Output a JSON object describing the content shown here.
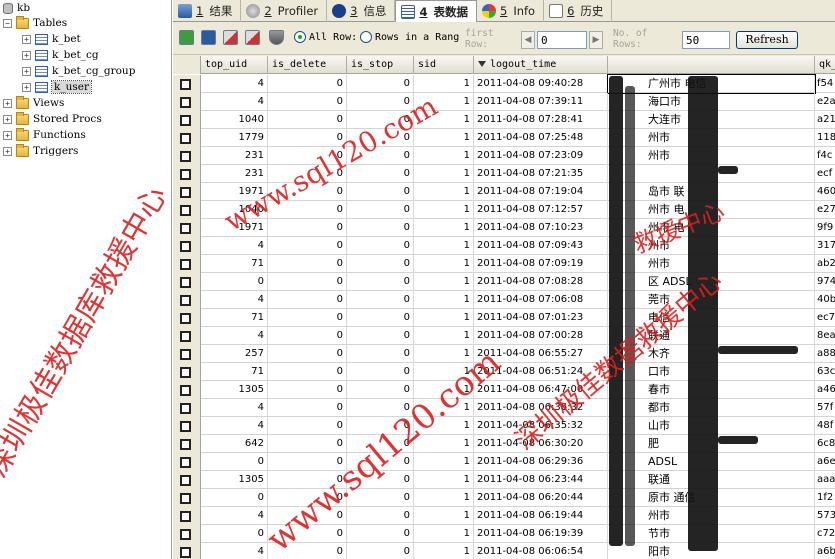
{
  "tree": {
    "root": "kb",
    "tables_label": "Tables",
    "tables": [
      "k_bet",
      "k_bet_cg",
      "k_bet_cg_group",
      "k_user"
    ],
    "selected_table": "k_user",
    "folders": [
      "Views",
      "Stored Procs",
      "Functions",
      "Triggers"
    ]
  },
  "tabs": [
    {
      "num": "1",
      "label": "结果",
      "active": false
    },
    {
      "num": "2",
      "label": "Profiler",
      "active": false
    },
    {
      "num": "3",
      "label": "信息",
      "active": false
    },
    {
      "num": "4",
      "label": "表数据",
      "active": true
    },
    {
      "num": "5",
      "label": "Info",
      "active": false
    },
    {
      "num": "6",
      "label": "历史",
      "active": false
    }
  ],
  "toolbar": {
    "all_rows_label": "All Row:",
    "rows_in_range_label": "Rows in a Rang",
    "first_row_label": "first\nRow:",
    "first_row_value": "0",
    "num_rows_label": "No. of\nRows:",
    "num_rows_value": "50",
    "refresh_label": "Refresh"
  },
  "columns": [
    "top_uid",
    "is_delete",
    "is_stop",
    "sid",
    "logout_time",
    "",
    "qk_"
  ],
  "sorted_column": "logout_time",
  "rows": [
    {
      "top_uid": "4",
      "is_delete": "0",
      "is_stop": "0",
      "sid": "1",
      "logout_time": "2011-04-08 09:40:28",
      "loc": "广州市 电信",
      "qk": "f54"
    },
    {
      "top_uid": "4",
      "is_delete": "0",
      "is_stop": "0",
      "sid": "1",
      "logout_time": "2011-04-08 07:39:11",
      "loc": "海口市",
      "qk": "e2a"
    },
    {
      "top_uid": "1040",
      "is_delete": "0",
      "is_stop": "0",
      "sid": "1",
      "logout_time": "2011-04-08 07:28:41",
      "loc": "大连市",
      "qk": "a21"
    },
    {
      "top_uid": "1779",
      "is_delete": "0",
      "is_stop": "0",
      "sid": "1",
      "logout_time": "2011-04-08 07:25:48",
      "loc": "州市",
      "qk": "118"
    },
    {
      "top_uid": "231",
      "is_delete": "0",
      "is_stop": "0",
      "sid": "1",
      "logout_time": "2011-04-08 07:23:09",
      "loc": "州市",
      "qk": "f4c"
    },
    {
      "top_uid": "231",
      "is_delete": "0",
      "is_stop": "0",
      "sid": "1",
      "logout_time": "2011-04-08 07:21:35",
      "loc": "",
      "qk": "ecf"
    },
    {
      "top_uid": "1971",
      "is_delete": "0",
      "is_stop": "0",
      "sid": "1",
      "logout_time": "2011-04-08 07:19:04",
      "loc": "岛市 联",
      "qk": "460"
    },
    {
      "top_uid": "1040",
      "is_delete": "0",
      "is_stop": "0",
      "sid": "1",
      "logout_time": "2011-04-08 07:12:57",
      "loc": "州市 电",
      "qk": "e27"
    },
    {
      "top_uid": "1971",
      "is_delete": "0",
      "is_stop": "0",
      "sid": "1",
      "logout_time": "2011-04-08 07:10:23",
      "loc": "州市 电",
      "qk": "9f9"
    },
    {
      "top_uid": "4",
      "is_delete": "0",
      "is_stop": "0",
      "sid": "1",
      "logout_time": "2011-04-08 07:09:43",
      "loc": "州市",
      "qk": "317"
    },
    {
      "top_uid": "71",
      "is_delete": "0",
      "is_stop": "0",
      "sid": "1",
      "logout_time": "2011-04-08 07:09:19",
      "loc": "州市",
      "qk": "ab2"
    },
    {
      "top_uid": "0",
      "is_delete": "0",
      "is_stop": "0",
      "sid": "1",
      "logout_time": "2011-04-08 07:08:28",
      "loc": "区 ADSL",
      "qk": "974"
    },
    {
      "top_uid": "4",
      "is_delete": "0",
      "is_stop": "0",
      "sid": "1",
      "logout_time": "2011-04-08 07:06:08",
      "loc": "莞市",
      "qk": "40b"
    },
    {
      "top_uid": "71",
      "is_delete": "0",
      "is_stop": "0",
      "sid": "1",
      "logout_time": "2011-04-08 07:01:23",
      "loc": "电信",
      "qk": "ec7"
    },
    {
      "top_uid": "4",
      "is_delete": "0",
      "is_stop": "0",
      "sid": "1",
      "logout_time": "2011-04-08 07:00:28",
      "loc": "联通",
      "qk": "8ea"
    },
    {
      "top_uid": "257",
      "is_delete": "0",
      "is_stop": "0",
      "sid": "1",
      "logout_time": "2011-04-08 06:55:27",
      "loc": "木齐",
      "qk": "a88"
    },
    {
      "top_uid": "71",
      "is_delete": "0",
      "is_stop": "0",
      "sid": "1",
      "logout_time": "2011-04-08 06:51:24",
      "loc": "口市",
      "qk": "63c"
    },
    {
      "top_uid": "1305",
      "is_delete": "0",
      "is_stop": "0",
      "sid": "1",
      "logout_time": "2011-04-08 06:47:00",
      "loc": "春市",
      "qk": "a46"
    },
    {
      "top_uid": "4",
      "is_delete": "0",
      "is_stop": "0",
      "sid": "1",
      "logout_time": "2011-04-08 06:36:32",
      "loc": "都市",
      "qk": "57f"
    },
    {
      "top_uid": "4",
      "is_delete": "0",
      "is_stop": "0",
      "sid": "1",
      "logout_time": "2011-04-08 06:35:32",
      "loc": "山市",
      "qk": "48f"
    },
    {
      "top_uid": "642",
      "is_delete": "0",
      "is_stop": "0",
      "sid": "1",
      "logout_time": "2011-04-08 06:30:20",
      "loc": "肥",
      "qk": "6c8"
    },
    {
      "top_uid": "0",
      "is_delete": "0",
      "is_stop": "0",
      "sid": "1",
      "logout_time": "2011-04-08 06:29:36",
      "loc": "ADSL",
      "qk": "a6e"
    },
    {
      "top_uid": "1305",
      "is_delete": "0",
      "is_stop": "0",
      "sid": "1",
      "logout_time": "2011-04-08 06:23:44",
      "loc": "联通",
      "qk": "aaa"
    },
    {
      "top_uid": "0",
      "is_delete": "0",
      "is_stop": "0",
      "sid": "1",
      "logout_time": "2011-04-08 06:20:44",
      "loc": "原市 通信",
      "qk": "1f2"
    },
    {
      "top_uid": "4",
      "is_delete": "0",
      "is_stop": "0",
      "sid": "1",
      "logout_time": "2011-04-08 06:19:44",
      "loc": "州市",
      "qk": "573"
    },
    {
      "top_uid": "0",
      "is_delete": "0",
      "is_stop": "0",
      "sid": "1",
      "logout_time": "2011-04-08 06:19:39",
      "loc": "节市",
      "qk": "c72"
    },
    {
      "top_uid": "4",
      "is_delete": "0",
      "is_stop": "0",
      "sid": "1",
      "logout_time": "2011-04-08 06:06:54",
      "loc": "阳市",
      "qk": "a6b"
    }
  ],
  "watermarks": {
    "url": "www.sql120.com",
    "org": "深圳极佳数据库救援中心",
    "org_short": "深圳极佳数据救援中心",
    "org_short2": "救援中心"
  },
  "colors": {
    "watermark": "#da1e1e",
    "chrome": "#ece9d8",
    "selection": "#d8d8d8"
  }
}
